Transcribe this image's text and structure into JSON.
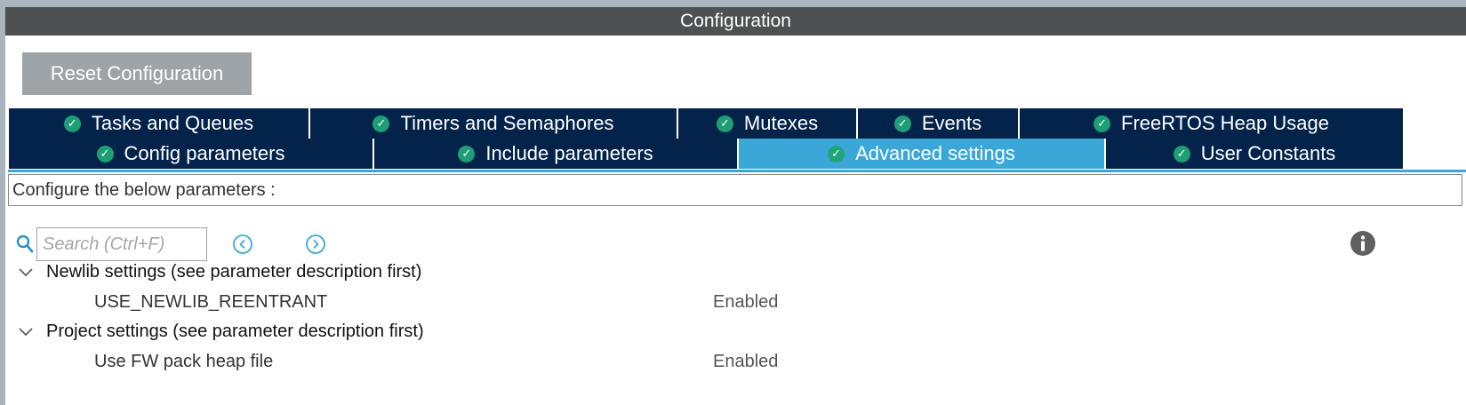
{
  "window": {
    "title": "Configuration"
  },
  "toolbar": {
    "reset_label": "Reset Configuration"
  },
  "tabs_row1": [
    {
      "label": "Tasks and Queues"
    },
    {
      "label": "Timers and Semaphores"
    },
    {
      "label": "Mutexes"
    },
    {
      "label": "Events"
    },
    {
      "label": "FreeRTOS Heap Usage"
    }
  ],
  "tabs_row2": [
    {
      "label": "Config parameters"
    },
    {
      "label": "Include parameters"
    },
    {
      "label": "Advanced settings",
      "active": true
    },
    {
      "label": "User Constants"
    }
  ],
  "description": "Configure the below parameters :",
  "search": {
    "placeholder": "Search (Ctrl+F)",
    "value": ""
  },
  "groups": [
    {
      "label": "Newlib settings (see parameter description first)",
      "params": [
        {
          "name": "USE_NEWLIB_REENTRANT",
          "value": "Enabled"
        }
      ]
    },
    {
      "label": "Project settings (see parameter description first)",
      "params": [
        {
          "name": "Use FW pack heap file",
          "value": "Enabled"
        }
      ]
    }
  ],
  "icons": {
    "tab_status": "check-circle-icon",
    "search": "search-icon",
    "prev": "chevron-left-circle-icon",
    "next": "chevron-right-circle-icon",
    "info": "info-icon",
    "group_toggle": "chevron-down-icon"
  },
  "colors": {
    "title_bar": "#4f5051",
    "tab_bg": "#03234b",
    "tab_active": "#3ba7d9",
    "check": "#1d9e74",
    "reset_button": "#9ea3a7"
  }
}
